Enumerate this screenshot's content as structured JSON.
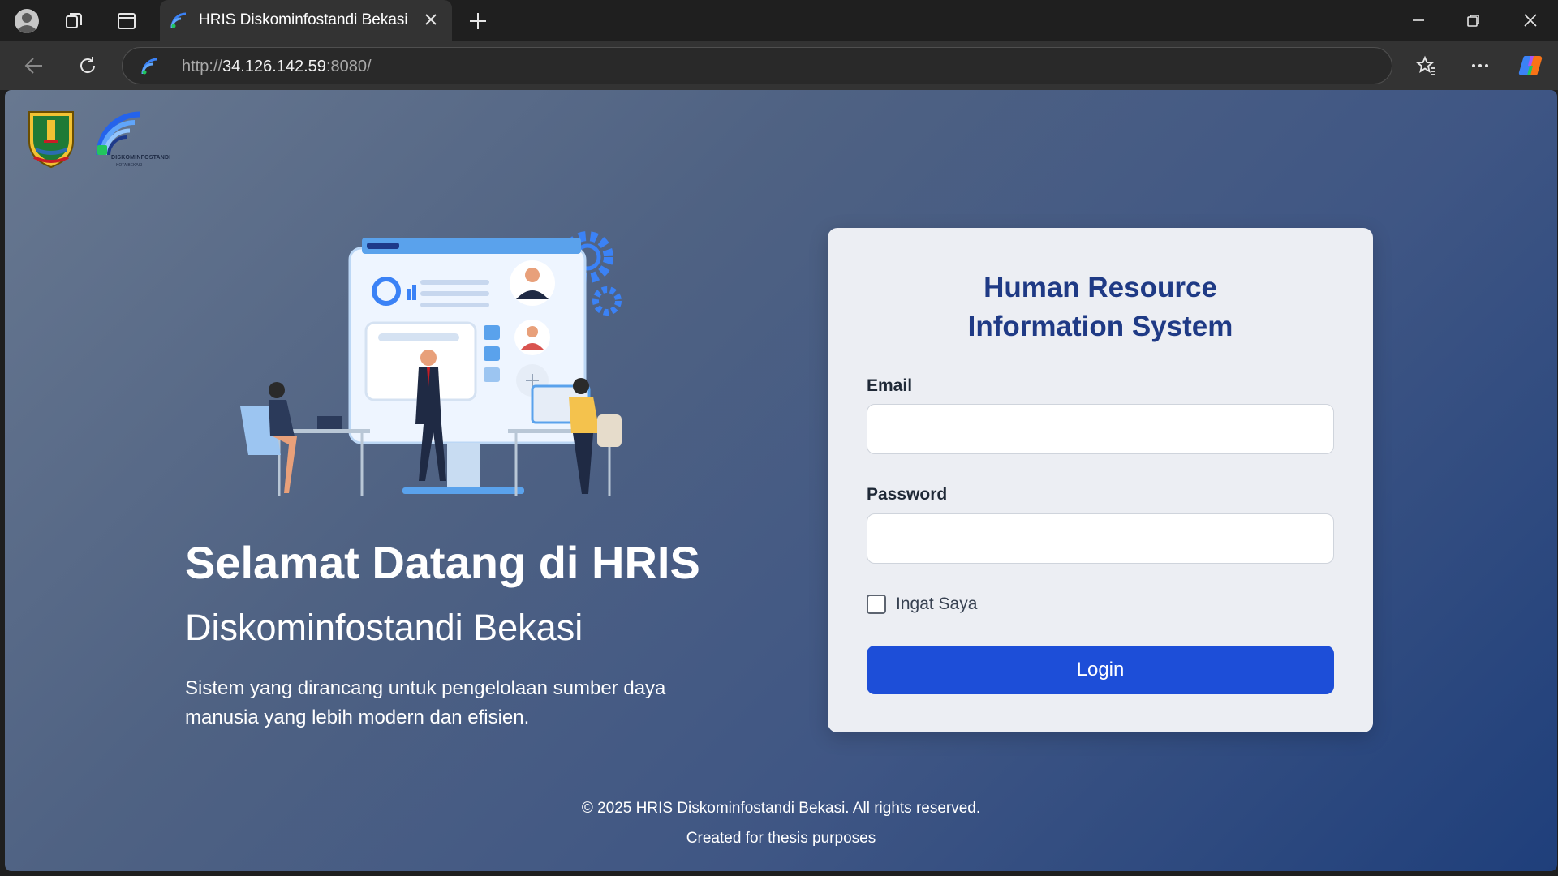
{
  "browser": {
    "tab_title": "HRIS Diskominfostandi Bekasi",
    "url_prefix": "http://",
    "url_host": "34.126.142.59",
    "url_suffix": ":8080/"
  },
  "logos": {
    "agency_name": "DISKOMINFOSTANDI",
    "agency_sub": "KOTA BEKASI"
  },
  "hero": {
    "title": "Selamat Datang di HRIS",
    "subtitle": "Diskominfostandi Bekasi",
    "description": "Sistem yang dirancang untuk pengelolaan sumber daya manusia yang lebih modern dan efisien."
  },
  "login": {
    "title_line1": "Human Resource",
    "title_line2": "Information System",
    "email_label": "Email",
    "email_value": "",
    "password_label": "Password",
    "password_value": "",
    "remember_label": "Ingat Saya",
    "remember_checked": false,
    "button_label": "Login"
  },
  "footer": {
    "copyright": "© 2025 HRIS Diskominfostandi Bekasi. All rights reserved.",
    "note": "Created for thesis purposes"
  },
  "colors": {
    "accent": "#1d4ed8",
    "title": "#1f3a85"
  }
}
